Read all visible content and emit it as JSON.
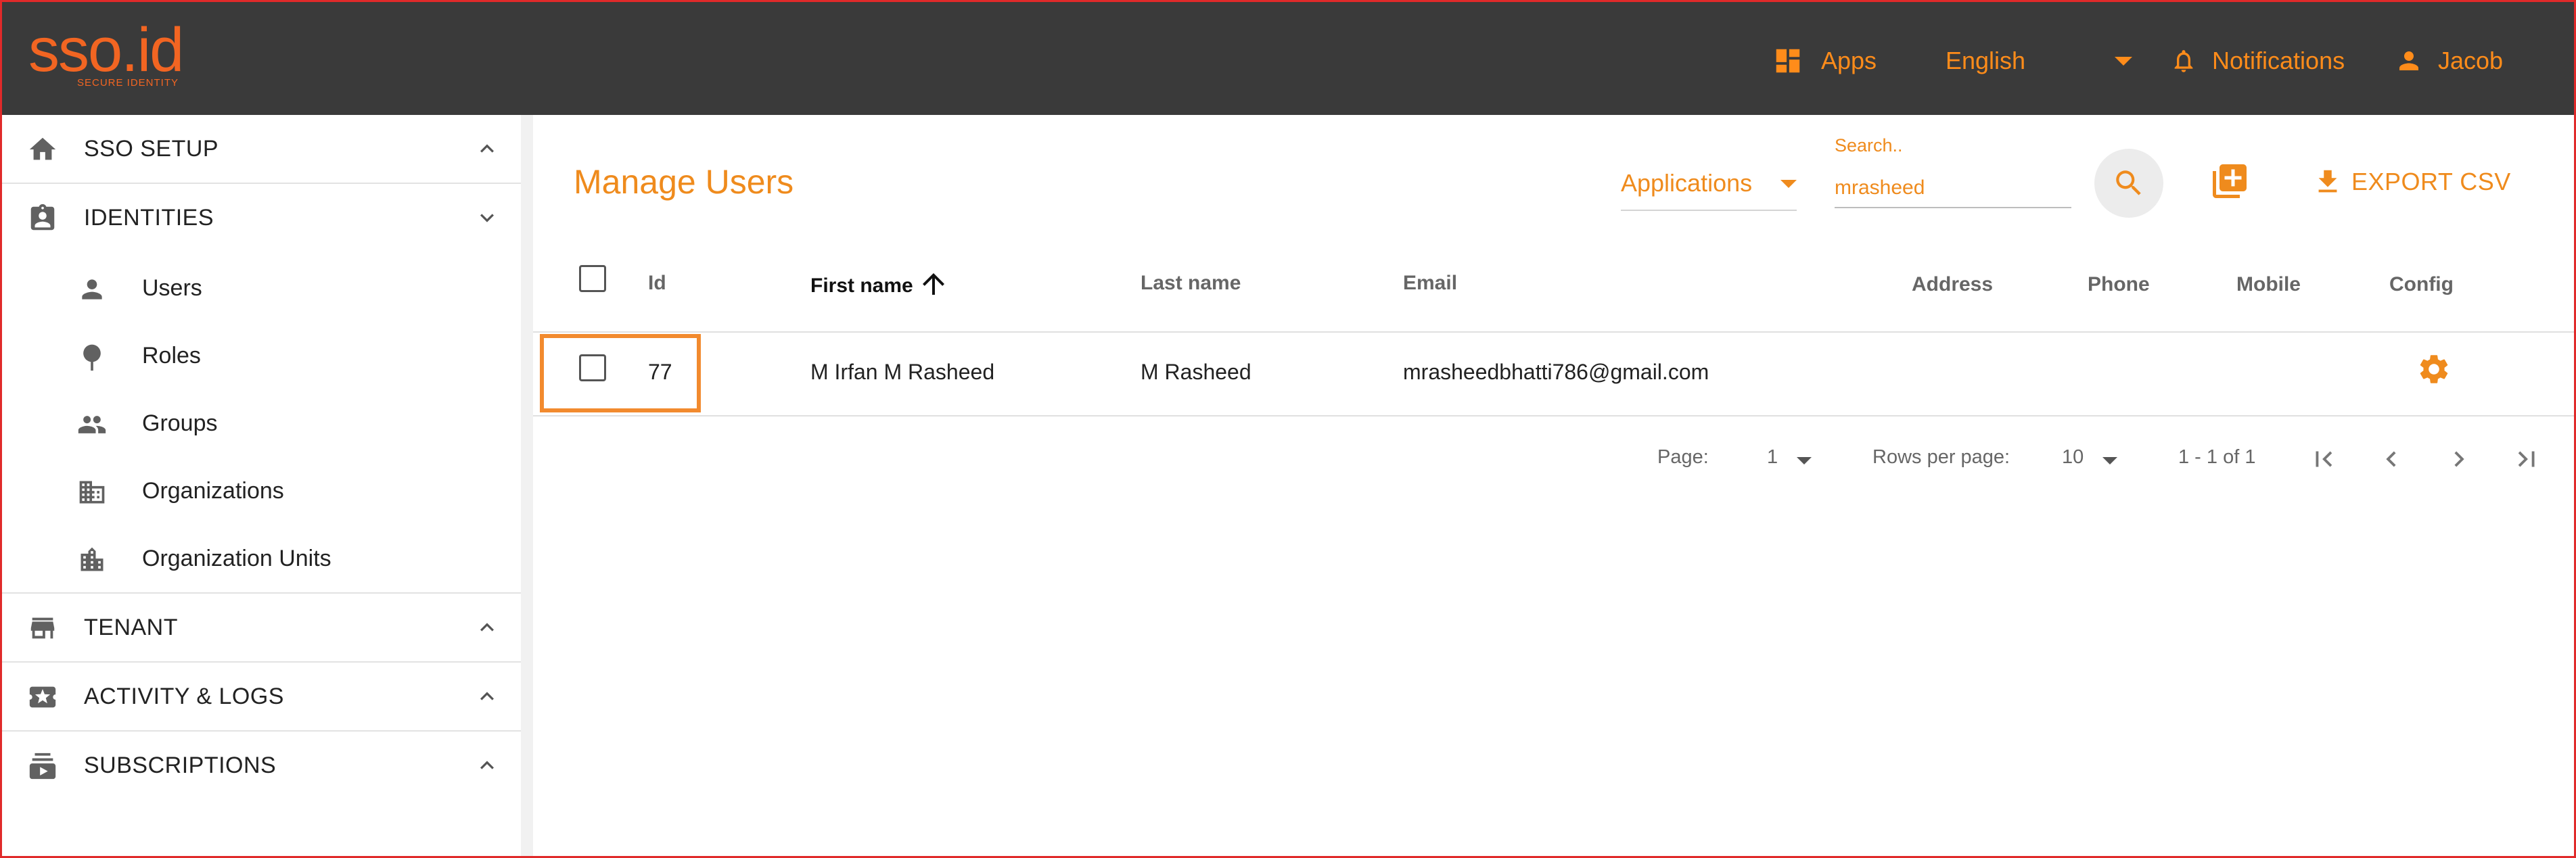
{
  "header": {
    "logo_text": "sso.id",
    "logo_subtitle": "SECURE IDENTITY",
    "apps_label": "Apps",
    "language_label": "English",
    "notifications_label": "Notifications",
    "user_label": "Jacob"
  },
  "sidebar": {
    "sections": [
      {
        "label": "SSO SETUP",
        "icon": "home-icon",
        "state": "collapsed"
      },
      {
        "label": "IDENTITIES",
        "icon": "badge-icon",
        "state": "expanded"
      },
      {
        "label": "TENANT",
        "icon": "store-icon",
        "state": "collapsed"
      },
      {
        "label": "ACTIVITY & LOGS",
        "icon": "ticket-icon",
        "state": "collapsed"
      },
      {
        "label": "SUBSCRIPTIONS",
        "icon": "subscriptions-icon",
        "state": "collapsed"
      }
    ],
    "identities_items": [
      {
        "label": "Users",
        "icon": "person-icon"
      },
      {
        "label": "Roles",
        "icon": "pin-icon"
      },
      {
        "label": "Groups",
        "icon": "group-icon"
      },
      {
        "label": "Organizations",
        "icon": "building-icon"
      },
      {
        "label": "Organization Units",
        "icon": "city-icon"
      }
    ]
  },
  "main": {
    "title": "Manage Users",
    "applications_label": "Applications",
    "search": {
      "label": "Search..",
      "value": "mrasheed"
    },
    "export_label": "EXPORT CSV",
    "columns": [
      "Id",
      "First name",
      "Last name",
      "Email",
      "Address",
      "Phone",
      "Mobile",
      "Config"
    ],
    "rows": [
      {
        "id": "77",
        "first_name": "M Irfan M Rasheed",
        "last_name": "M Rasheed",
        "email": "mrasheedbhatti786@gmail.com",
        "address": "",
        "phone": "",
        "mobile": ""
      }
    ],
    "pagination": {
      "page_label": "Page:",
      "page_value": "1",
      "rows_label": "Rows per page:",
      "rows_value": "10",
      "range": "1 - 1 of 1"
    }
  },
  "colors": {
    "accent": "#ef8b1d",
    "header_bg": "#3a3a3a",
    "highlight": "#f28a2e"
  }
}
